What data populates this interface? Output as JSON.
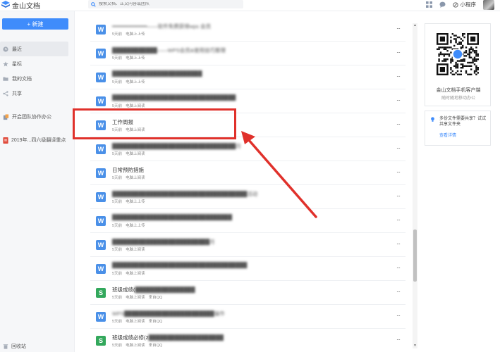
{
  "app": {
    "name": "金山文档",
    "search_placeholder": "搜索文档、正文内容或团队",
    "mini_program_label": "小程序"
  },
  "sidebar": {
    "new_button": "+ 新建",
    "items": [
      {
        "label": "最近",
        "icon": "clock-icon",
        "active": true
      },
      {
        "label": "星标",
        "icon": "star-icon"
      },
      {
        "label": "我的文档",
        "icon": "folder-icon"
      },
      {
        "label": "共享",
        "icon": "share-icon"
      }
    ],
    "team_label": "开启团队协作办公",
    "pinned_label": "2019年...四六级翻译重点",
    "recycle_label": "回收站"
  },
  "files": [
    {
      "type": "W",
      "title": "━━━━━━━━━━━——软件免费获得wps 会员",
      "blurred": true,
      "time": "5天前",
      "action": "电脑上上传",
      "source": ""
    },
    {
      "type": "W",
      "title": "████████████——WPS会员&使用技巧整理",
      "blurred": true,
      "time": "5天前",
      "action": "电脑上上传",
      "source": ""
    },
    {
      "type": "W",
      "title": "████████████████████████",
      "blurred": true,
      "time": "5天前",
      "action": "电脑上上传",
      "source": ""
    },
    {
      "type": "W",
      "title": "█████████████████████████████████",
      "blurred": true,
      "time": "5天前",
      "action": "电脑上阅读",
      "source": ""
    },
    {
      "type": "W",
      "title": "工作周报",
      "blurred": false,
      "time": "5天前",
      "action": "电脑上阅读",
      "source": ""
    },
    {
      "type": "W",
      "title": "█████████████████████████████████月",
      "blurred": true,
      "time": "5天前",
      "action": "电脑上阅读",
      "source": ""
    },
    {
      "type": "W",
      "title": "日常预防措施",
      "blurred": false,
      "time": "5天前",
      "action": "电脑上阅读",
      "source": ""
    },
    {
      "type": "W",
      "title": "████████████████████████████████████活动",
      "blurred": true,
      "time": "5天前",
      "action": "电脑上上传",
      "source": ""
    },
    {
      "type": "W",
      "title": "████████████████████████████████",
      "blurred": true,
      "time": "5天前",
      "action": "电脑上上传",
      "source": ""
    },
    {
      "type": "W",
      "title": "██████████████████████████月",
      "blurred": true,
      "time": "5天前",
      "action": "电脑上阅读",
      "source": ""
    },
    {
      "type": "W",
      "title": "████████████████████████████████████",
      "blurred": true,
      "time": "5天前",
      "action": "电脑上阅读",
      "source": ""
    },
    {
      "type": "S",
      "title": "班级成绩(████████████████",
      "blurred": "partial",
      "prefix": "班级成绩(",
      "time": "5天前",
      "action": "电脑上阅读",
      "source": "来自QQ"
    },
    {
      "type": "W",
      "title": "WPS████████████████████████操作",
      "blurred": true,
      "time": "5天前",
      "action": "电脑上阅读",
      "source": "来自QQ"
    },
    {
      "type": "S",
      "title": "班级成绩必修(2████████████████████",
      "blurred": "partial",
      "prefix": "班级成绩必修(2",
      "time": "5天前",
      "action": "电脑上阅读",
      "source": "来自QQ"
    }
  ],
  "more_label": "···",
  "qr_card": {
    "title": "金山文档手机客户端",
    "subtitle": "随时随地移动办公"
  },
  "tip_card": {
    "text": "多份文件需要共享？试试共享文件夹",
    "link": "查看详情"
  },
  "colors": {
    "primary": "#3f8cfb",
    "word_icon": "#4a90e8",
    "sheet_icon": "#33a85c",
    "annotation": "#e0312b"
  }
}
